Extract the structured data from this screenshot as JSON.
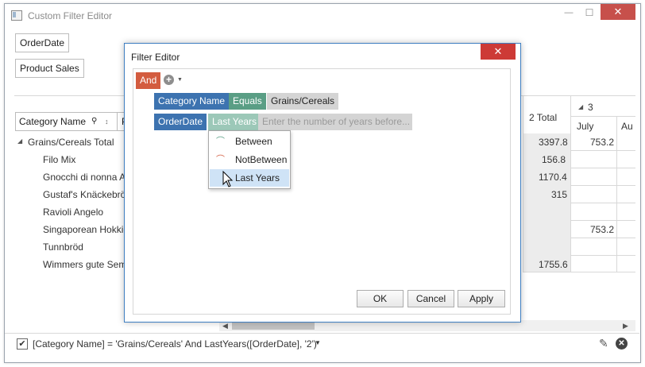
{
  "window": {
    "title": "Custom Filter Editor",
    "controls": {
      "minimize": "—",
      "maximize": "☐",
      "close": "✕"
    }
  },
  "fields": {
    "filter_area": [
      "OrderDate",
      "Product Sales"
    ],
    "row_header": "Category Name",
    "row_header_next": "P"
  },
  "grid": {
    "group_row": "Grains/Cereals Total",
    "rows": [
      "Filo Mix",
      "Gnocchi di nonna A",
      "Gustaf's Knäckebröd",
      "Ravioli Angelo",
      "Singaporean Hokkie",
      "Tunnbröd",
      "Wimmers gute Sem"
    ],
    "col_headers": {
      "year_fragment": "2 Total",
      "year3": "3",
      "month1": "July",
      "month2": "Au"
    },
    "total_col": [
      "3397.8",
      "156.8",
      "1170.4",
      "315",
      "",
      "",
      "",
      "1755.6"
    ],
    "july_col": [
      "753.2",
      "",
      "",
      "",
      "",
      "753.2",
      "",
      ""
    ]
  },
  "filter_bar": {
    "checked": true,
    "expression": "[Category Name] = 'Grains/Cereals' And LastYears([OrderDate], '2')"
  },
  "dialog": {
    "title": "Filter Editor",
    "close": "✕",
    "group_operator": "And",
    "conditions": [
      {
        "field": "Category Name",
        "operator": "Equals",
        "value": "Grains/Cereals"
      },
      {
        "field": "OrderDate",
        "operator": "Last Years",
        "placeholder": "Enter the number of years before..."
      }
    ],
    "operator_menu": [
      "Between",
      "NotBetween",
      "Last Years"
    ],
    "buttons": {
      "ok": "OK",
      "cancel": "Cancel",
      "apply": "Apply"
    }
  },
  "colors": {
    "and_chip": "#d35c3f",
    "field_chip": "#3d73b0",
    "operator_chip": "#5a9e85",
    "operator_chip_light": "#9cc8b8",
    "value_chip": "#d4d4d4",
    "dialog_close": "#cd3a36"
  }
}
